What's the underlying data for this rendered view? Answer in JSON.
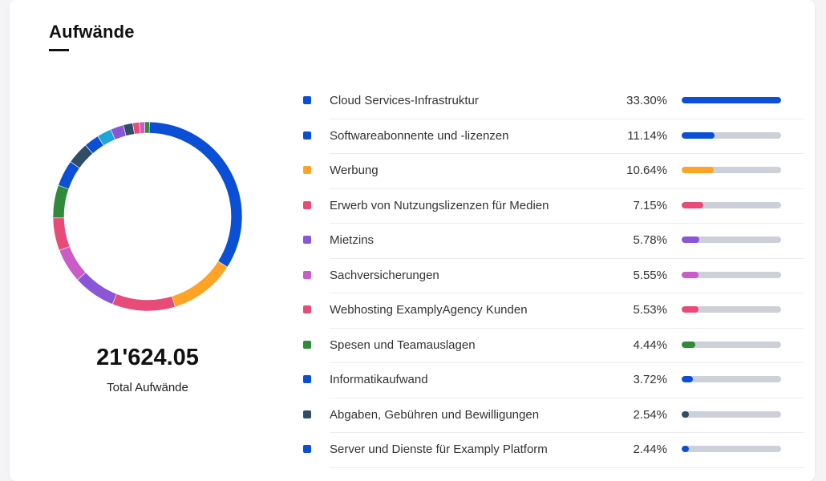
{
  "card": {
    "title": "Aufwände"
  },
  "summary": {
    "total_value": "21'624.05",
    "total_label": "Total Aufwände"
  },
  "colors": {
    "track": "#cdd0d8",
    "blue": "#0a4fd6",
    "orange": "#ffa327",
    "pink": "#e64c77",
    "purple": "#8a55d6",
    "magenta": "#c95cc6",
    "green": "#2f8a3a",
    "slate": "#2f4d66",
    "cyan": "#1fa6d9"
  },
  "items": [
    {
      "label": "Cloud Services-Infrastruktur",
      "pct_text": "33.30%",
      "value": 33.3,
      "color": "#0a4fd6"
    },
    {
      "label": "Softwareabonnente und -lizenzen",
      "pct_text": "11.14%",
      "value": 11.14,
      "color": "#0a4fd6"
    },
    {
      "label": "Werbung",
      "pct_text": "10.64%",
      "value": 10.64,
      "color": "#ffa327"
    },
    {
      "label": "Erwerb von Nutzungslizenzen für Medien",
      "pct_text": "7.15%",
      "value": 7.15,
      "color": "#e64c77"
    },
    {
      "label": "Mietzins",
      "pct_text": "5.78%",
      "value": 5.78,
      "color": "#8a55d6"
    },
    {
      "label": "Sachversicherungen",
      "pct_text": "5.55%",
      "value": 5.55,
      "color": "#c95cc6"
    },
    {
      "label": "Webhosting ExamplyAgency Kunden",
      "pct_text": "5.53%",
      "value": 5.53,
      "color": "#e64c77"
    },
    {
      "label": "Spesen und Teamauslagen",
      "pct_text": "4.44%",
      "value": 4.44,
      "color": "#2f8a3a"
    },
    {
      "label": "Informatikaufwand",
      "pct_text": "3.72%",
      "value": 3.72,
      "color": "#0a4fd6"
    },
    {
      "label": "Abgaben, Gebühren und Bewilligungen",
      "pct_text": "2.54%",
      "value": 2.54,
      "color": "#2f4d66"
    },
    {
      "label": "Server und Dienste für Examply Platform",
      "pct_text": "2.44%",
      "value": 2.44,
      "color": "#0a4fd6"
    }
  ],
  "chart_data": {
    "type": "pie",
    "categories": [
      "Cloud Services-Infrastruktur",
      "Softwareabonnente und -lizenzen",
      "Werbung",
      "Erwerb von Nutzungslizenzen für Medien",
      "Mietzins",
      "Sachversicherungen",
      "Webhosting ExamplyAgency Kunden",
      "Spesen und Teamauslagen",
      "Informatikaufwand",
      "Abgaben, Gebühren und Bewilligungen",
      "Server und Dienste für Examply Platform"
    ],
    "values": [
      33.3,
      11.14,
      10.64,
      7.15,
      5.78,
      5.55,
      5.53,
      4.44,
      3.72,
      2.54,
      2.44
    ],
    "colors": [
      "#0a4fd6",
      "#ffa327",
      "#e64c77",
      "#8a55d6",
      "#c95cc6",
      "#e64c77",
      "#2f8a3a",
      "#0a4fd6",
      "#2f4d66",
      "#0a4fd6"
    ],
    "donut_segments": [
      {
        "value": 33.3,
        "color": "#0a4fd6"
      },
      {
        "value": 11.14,
        "color": "#ffa327"
      },
      {
        "value": 10.64,
        "color": "#e64c77"
      },
      {
        "value": 7.15,
        "color": "#8a55d6"
      },
      {
        "value": 5.78,
        "color": "#c95cc6"
      },
      {
        "value": 5.55,
        "color": "#e64c77"
      },
      {
        "value": 5.53,
        "color": "#2f8a3a"
      },
      {
        "value": 4.44,
        "color": "#0a4fd6"
      },
      {
        "value": 3.72,
        "color": "#2f4d66"
      },
      {
        "value": 2.54,
        "color": "#0a4fd6"
      },
      {
        "value": 2.44,
        "color": "#1fa6d9"
      },
      {
        "value": 2.2,
        "color": "#8a55d6"
      },
      {
        "value": 1.6,
        "color": "#2f4d66"
      },
      {
        "value": 1.1,
        "color": "#e64c77"
      },
      {
        "value": 0.9,
        "color": "#c95cc6"
      },
      {
        "value": 0.8,
        "color": "#2f8a3a"
      }
    ],
    "center_value": "21'624.05",
    "center_label": "Total Aufwände"
  }
}
